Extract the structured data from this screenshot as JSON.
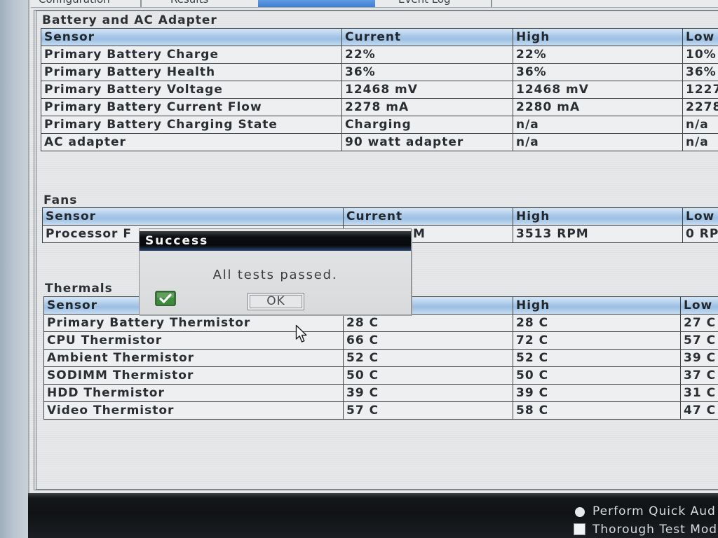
{
  "tabs": [
    {
      "label": "Configuration"
    },
    {
      "label": "Results"
    },
    {
      "selected": true
    },
    {
      "label": "Event Log"
    }
  ],
  "battery": {
    "title": "Battery and AC Adapter",
    "headers": [
      "Sensor",
      "Current",
      "High",
      "Low"
    ],
    "rows": [
      {
        "sensor": "Primary Battery Charge",
        "current": "22%",
        "high": "22%",
        "low": "10%"
      },
      {
        "sensor": "Primary Battery Health",
        "current": "36%",
        "high": "36%",
        "low": "36%"
      },
      {
        "sensor": "Primary Battery Voltage",
        "current": "12468 mV",
        "high": "12468 mV",
        "low": "1227"
      },
      {
        "sensor": "Primary Battery Current Flow",
        "current": "2278 mA",
        "high": "2280 mA",
        "low": "2278"
      },
      {
        "sensor": "Primary Battery Charging State",
        "current": "Charging",
        "high": "n/a",
        "low": "n/a"
      },
      {
        "sensor": "AC adapter",
        "current": "90 watt adapter",
        "high": "n/a",
        "low": "n/a"
      }
    ]
  },
  "fans": {
    "title": "Fans",
    "headers": [
      "Sensor",
      "Current",
      "High",
      "Low"
    ],
    "rows": [
      {
        "sensor": "Processor F",
        "current": "M",
        "high": "3513 RPM",
        "low": "0 RP"
      }
    ]
  },
  "thermals": {
    "title": "Thermals",
    "headers": [
      "Sensor",
      "",
      "High",
      "Low"
    ],
    "rows": [
      {
        "sensor": "Primary Battery Thermistor",
        "current": "28 C",
        "high": "28 C",
        "low": "27 C"
      },
      {
        "sensor": "CPU Thermistor",
        "current": "66 C",
        "high": "72 C",
        "low": "57 C"
      },
      {
        "sensor": "Ambient Thermistor",
        "current": "52 C",
        "high": "52 C",
        "low": "39 C"
      },
      {
        "sensor": "SODIMM Thermistor",
        "current": "50 C",
        "high": "50 C",
        "low": "37 C"
      },
      {
        "sensor": "HDD Thermistor",
        "current": "39 C",
        "high": "39 C",
        "low": "31 C"
      },
      {
        "sensor": "Video Thermistor",
        "current": "57 C",
        "high": "58 C",
        "low": "47 C"
      }
    ]
  },
  "dialog": {
    "title": "Success",
    "message": "All tests passed.",
    "icon": "checkmark-icon",
    "ok_label": "OK"
  },
  "footer": {
    "options": [
      {
        "label": "Perform Quick Aud",
        "icon": "radio-dot-icon",
        "selected": true
      },
      {
        "label": "Thorough Test Mod",
        "icon": "checkbox-icon",
        "checked": false
      }
    ]
  },
  "cursor": {
    "icon": "arrow-pointer-icon"
  },
  "colors": {
    "header_blue": "#a7c7e7",
    "selected_tab": "#3a7ccf",
    "dialog_title_bar": "#0b0d10",
    "check_green": "#3d8a3c",
    "footer_band": "#14171a"
  }
}
